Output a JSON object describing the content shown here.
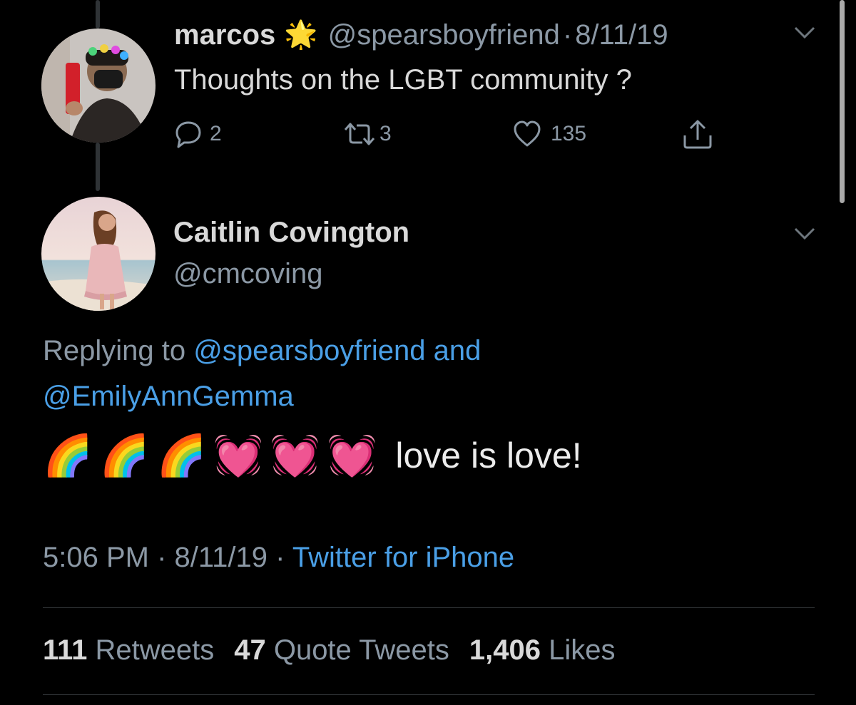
{
  "parent_tweet": {
    "display_name": "marcos",
    "badge_emoji": "🌟",
    "handle": "@spearsboyfriend",
    "separator": "·",
    "date": "8/11/19",
    "text": "Thoughts on the LGBT community ?",
    "reply_count": "2",
    "retweet_count": "3",
    "like_count": "135"
  },
  "main_tweet": {
    "display_name": "Caitlin Covington",
    "handle": "@cmcoving",
    "replying_prefix": "Replying to",
    "replying_user_1": "@spearsboyfriend",
    "replying_and": "and",
    "replying_user_2": "@EmilyAnnGemma",
    "emojis": "🌈🌈🌈💓💓💓",
    "text": "love is love!",
    "time": "5:06 PM",
    "meta_sep_1": "·",
    "date": "8/11/19",
    "meta_sep_2": "·",
    "source": "Twitter for iPhone"
  },
  "stats": {
    "retweets_count": "111",
    "retweets_label": "Retweets",
    "quotes_count": "47",
    "quotes_label": "Quote Tweets",
    "likes_count": "1,406",
    "likes_label": "Likes"
  },
  "colors": {
    "background": "#000000",
    "text": "#d9d9d9",
    "secondary": "#8b98a5",
    "link": "#4a9fe6",
    "divider": "#2f3336"
  }
}
